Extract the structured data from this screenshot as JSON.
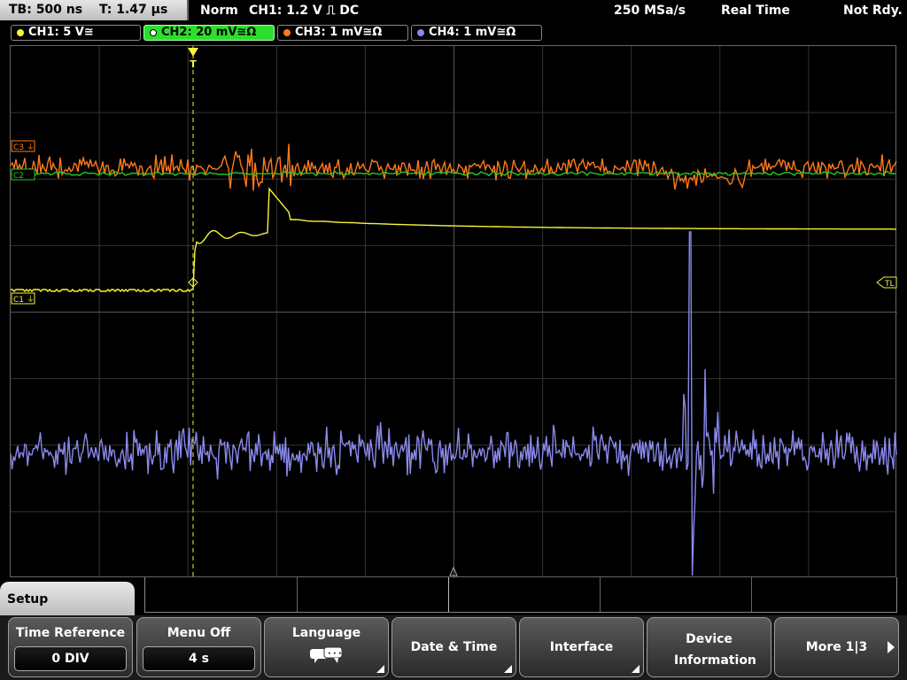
{
  "status_bar": {
    "timebase": "TB: 500 ns",
    "trigger_time": "T: 1.47 µs",
    "trigger_mode": "Norm",
    "trigger_setting": "CH1: 1.2 V ⎍ DC",
    "sample_rate": "250 MSa/s",
    "acq_mode": "Real Time",
    "state": "Not Rdy."
  },
  "channels": [
    {
      "label": "CH1: 5 V≅",
      "color": "#f5f53a",
      "active": false
    },
    {
      "label": "CH2: 20 mV≅Ω",
      "color": "#22cc22",
      "active": true
    },
    {
      "label": "CH3: 1 mV≅Ω",
      "color": "#ff7a1a",
      "active": false
    },
    {
      "label": "CH4: 1 mV≅Ω",
      "color": "#8888ee",
      "active": false
    }
  ],
  "markers": {
    "c3": "C3",
    "c2": "C2",
    "c1": "C1",
    "tl": "TL",
    "trigger_pos": "T"
  },
  "menu": {
    "title": "Setup",
    "softkeys": [
      {
        "label": "Time Reference",
        "value": "0 DIV"
      },
      {
        "label": "Menu Off",
        "value": "4 s"
      },
      {
        "label": "Language",
        "icon": "speech-bubbles-icon"
      },
      {
        "label": "Date & Time"
      },
      {
        "label": "Interface"
      },
      {
        "label": "Device Information"
      },
      {
        "label": "More 1|3"
      }
    ]
  }
}
